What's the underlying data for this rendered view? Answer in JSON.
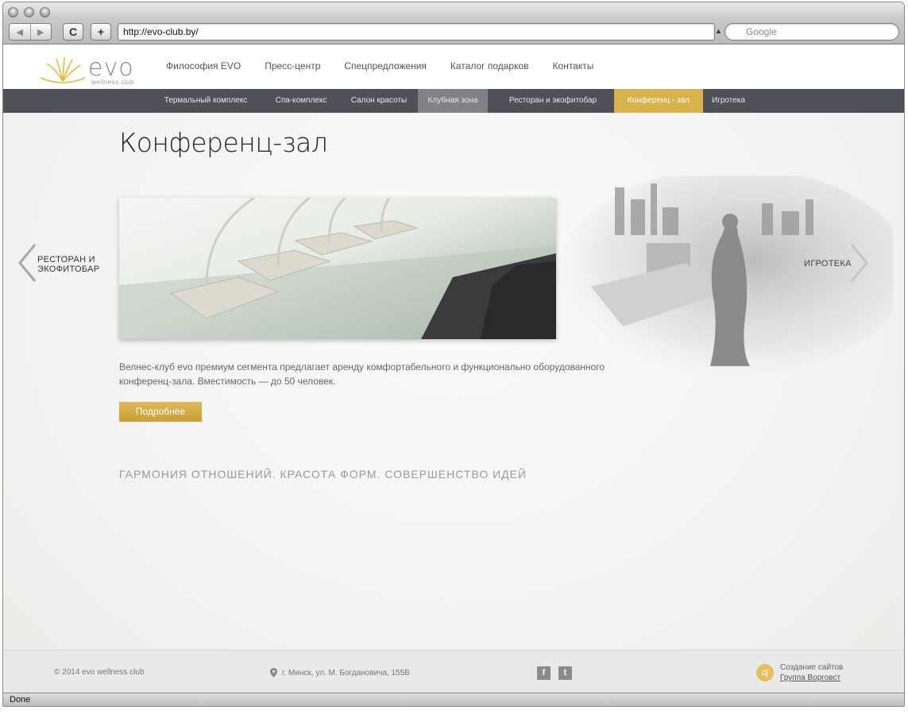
{
  "browser": {
    "url": "http://evo-club.by/",
    "search_placeholder": "Google",
    "status": "Done",
    "back_label": "◀",
    "forward_label": "▶",
    "reload_label": "C",
    "add_label": "+"
  },
  "header": {
    "logo_word": "evo",
    "logo_sub": "wellness club",
    "nav": [
      "Философия EVO",
      "Пресс-центр",
      "Спецпредложения",
      "Каталог подарков",
      "Контакты"
    ]
  },
  "subnav": {
    "items": [
      {
        "label": "Термальный комплекс",
        "state": "normal"
      },
      {
        "label": "Спа-комплекс",
        "state": "normal"
      },
      {
        "label": "Салон красоты",
        "state": "normal"
      },
      {
        "label": "Клубная зона",
        "state": "hover"
      },
      {
        "label": "Ресторан и экофитобар",
        "state": "normal"
      },
      {
        "label": "Конференц - зал",
        "state": "active"
      },
      {
        "label": "Игротека",
        "state": "normal"
      }
    ]
  },
  "main": {
    "title": "Конференц-зал",
    "prev_line1": "РЕСТОРАН И",
    "prev_line2": "ЭКОФИТОБАР",
    "next_label": "ИГРОТЕКА",
    "description": "Велнес-клуб evo премиум сегмента предлагает аренду комфортабельного и функционально оборудованного конференц-зала. Вместимость — до 50 человек.",
    "button": "Подробнее",
    "slogan": "ГАРМОНИЯ ОТНОШЕНИЙ. КРАСОТА ФОРМ. СОВЕРШЕНСТВО ИДЕЙ"
  },
  "footer": {
    "copyright": "© 2014 evo wellness club",
    "address": "г. Минск, ул. М. Богдановича, 155В",
    "social_fb": "f",
    "social_tw": "t",
    "dev_line1": "Создание сайтов",
    "dev_line2": "Группа Ворговст",
    "dev_logo": "dj"
  },
  "colors": {
    "accent": "#d8b24b",
    "subnav_bg": "#4f5159",
    "subnav_hover": "#808288"
  }
}
